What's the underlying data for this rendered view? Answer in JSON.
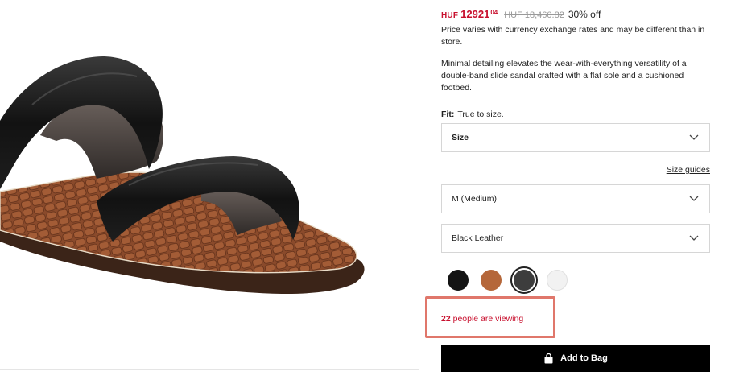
{
  "price": {
    "currency": "HUF",
    "sale_integer": "12921",
    "sale_decimal": "04",
    "original": "HUF 18,460.82",
    "discount": "30% off"
  },
  "disclaimer": "Price varies with currency exchange rates and may be different than in store.",
  "description": "Minimal detailing elevates the wear-with-everything versatility of a double-band slide sandal crafted with a flat sole and a cushioned footbed.",
  "fit": {
    "label": "Fit:",
    "value": "True to size."
  },
  "size_select": {
    "value": "Size",
    "icon": "chevron-down-icon"
  },
  "size_guides_label": "Size guides",
  "width_select": {
    "value": "M (Medium)",
    "icon": "chevron-down-icon"
  },
  "color_select": {
    "value": "Black Leather",
    "icon": "chevron-down-icon"
  },
  "swatches": [
    {
      "color": "#141414",
      "selected": false
    },
    {
      "color": "#b5673a",
      "selected": false
    },
    {
      "color": "#3d3d3d",
      "selected": true
    },
    {
      "color": "#f2f2f2",
      "selected": false
    }
  ],
  "viewing": {
    "count": "22",
    "text": " people are viewing"
  },
  "add_to_bag": {
    "label": "Add to Bag",
    "icon": "shopping-bag-icon"
  },
  "colors": {
    "sale": "#c8102e",
    "highlight_border": "#e0776b",
    "button_bg": "#000000"
  }
}
